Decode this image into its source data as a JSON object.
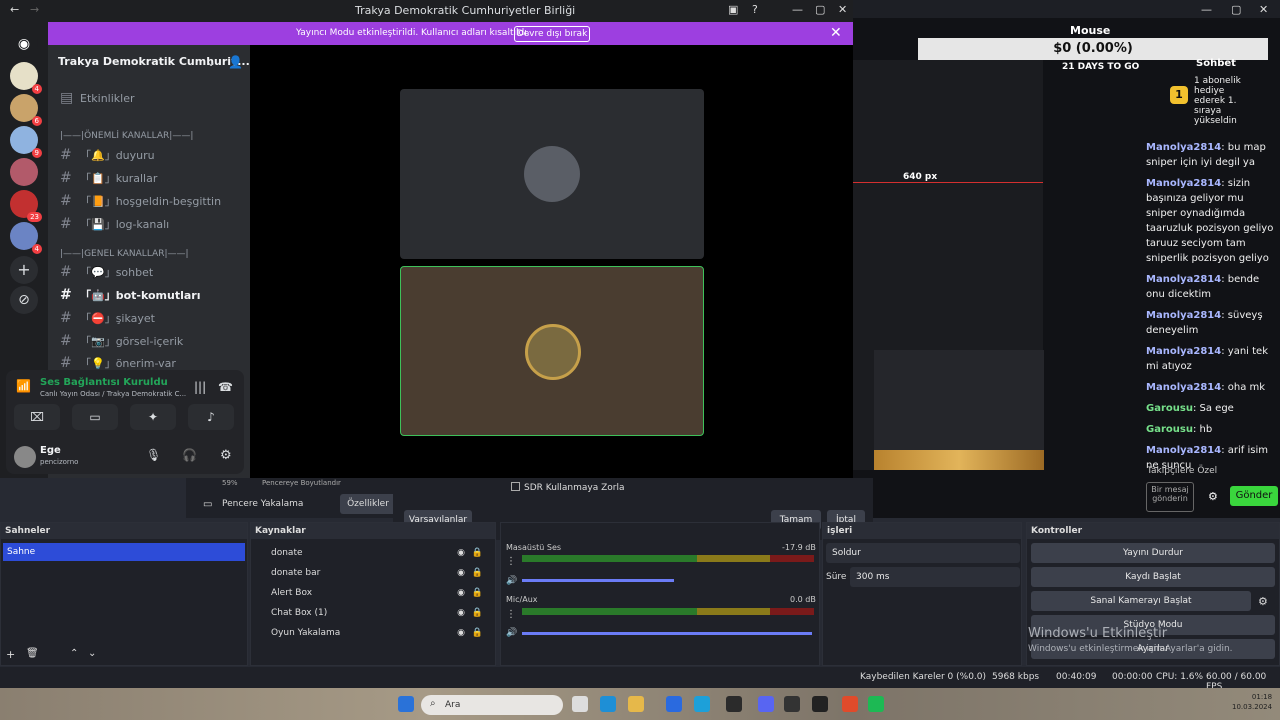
{
  "discord": {
    "window_title": "Trakya Demokratik Cumhuriyetler Birliği",
    "banner_text": "Yayıncı Modu etkinleştirildi. Kullanıcı adları kısaltıldı.",
    "banner_button": "Devre dışı bırak",
    "guild_name": "Trakya Demokratik Cumhuriy...",
    "events": "Etkinlikler",
    "categories": [
      "|——|ÖNEMLİ KANALLAR|——|",
      "|——|GENEL KANALLAR|——|"
    ],
    "important_channels": [
      "「🔔」duyuru",
      "「📋」kurallar",
      "「📙」hoşgeldin-beşgittin",
      "「💾」log-kanalı"
    ],
    "general_channels": [
      "「💬」sohbet",
      "「🤖」bot-komutları",
      "「⛔」şikayet",
      "「📷」görsel-içerik",
      "「💡」önerim-var"
    ],
    "server_badges": [
      "4",
      "6",
      "9",
      "23",
      "4"
    ],
    "voice": {
      "status": "Ses Bağlantısı Kuruldu",
      "channel": "Canlı Yayın Odası / Trakya Demokratik C..."
    },
    "user": {
      "name": "Ege",
      "status": "pencizorno"
    }
  },
  "obs": {
    "dialog": {
      "sdr_label": "SDR Kullanmaya Zorla",
      "defaults_button": "Varsayılanlar",
      "ok_button": "Tamam",
      "cancel_button": "İptal"
    },
    "window_capture_label": "Pencere Yakalama",
    "properties_button": "Özellikler",
    "resize_label": "Pencereye Boyutlandır",
    "zoom": "59%",
    "scenes": {
      "title": "Sahneler",
      "items": [
        "Sahne"
      ]
    },
    "sources": {
      "title": "Kaynaklar",
      "items": [
        "donate",
        "donate bar",
        "Alert Box",
        "Chat Box (1)",
        "Oyun Yakalama"
      ]
    },
    "mixer": {
      "channels": [
        {
          "name": "Masaüstü Ses",
          "db": "-17.9 dB"
        },
        {
          "name": "Mic/Aux",
          "db": "0.0 dB"
        }
      ],
      "ticks": [
        "-60",
        "-55",
        "-50",
        "-45",
        "-40",
        "-35",
        "-30",
        "-25",
        "-20",
        "-15",
        "-10",
        "-5",
        "0"
      ]
    },
    "transitions": {
      "title": "işleri",
      "type": "Soldur",
      "duration_label": "Süre",
      "duration": "300 ms"
    },
    "controls": {
      "title": "Kontroller",
      "buttons": [
        "Yayını Durdur",
        "Kaydı Başlat",
        "Sanal Kamerayı Başlat",
        "Stüdyo Modu",
        "Ayarlar"
      ]
    },
    "status": {
      "dropped": "Kaybedilen Kareler 0 (%0.0)",
      "bitrate": "5968 kbps",
      "stream_time": "00:40:09",
      "rec_time": "00:00:00",
      "cpu": "CPU: 1.6%",
      "fps": "60.00 / 60.00 FPS"
    },
    "watermark": {
      "title": "Windows'u Etkinleştir",
      "sub": "Windows'u etkinleştirmek için Ayarlar'a gidin."
    }
  },
  "preview": {
    "mouse_title": "Mouse",
    "money": "$0 (0.00%)",
    "days": "21 DAYS TO GO",
    "chat_title": "Sohbet",
    "gift": {
      "badge": "1",
      "text": "1 abonelik hediye ederek 1. sıraya yükseldin"
    },
    "px_label": "640 px",
    "chat": [
      {
        "user": "Manolya2814",
        "text": "bu map sniper için iyi degil ya"
      },
      {
        "user": "Manolya2814",
        "text": "sizin başınıza geliyor mu sniper oynadığımda taaruzluk pozisyon geliyo taruuz seciyom tam sniperlik pozisyon geliyo"
      },
      {
        "user": "Manolya2814",
        "text": "bende onu dicektim"
      },
      {
        "user": "Manolya2814",
        "text": "süveyş deneyelim"
      },
      {
        "user": "Manolya2814",
        "text": "yani tek mi atıyoz"
      },
      {
        "user": "Manolya2814",
        "text": "oha mk"
      },
      {
        "user": "Garousu",
        "text": "Sa ege"
      },
      {
        "user": "Garousu",
        "text": "hb"
      },
      {
        "user": "Manolya2814",
        "text": "arif isim ne suncu"
      }
    ],
    "followers_only": "Takipçilere Özel",
    "message_placeholder": "Bir mesaj gönderin",
    "send_button": "Gönder"
  },
  "taskbar": {
    "search": "Ara",
    "time": "01:18",
    "date": "10.03.2024"
  }
}
